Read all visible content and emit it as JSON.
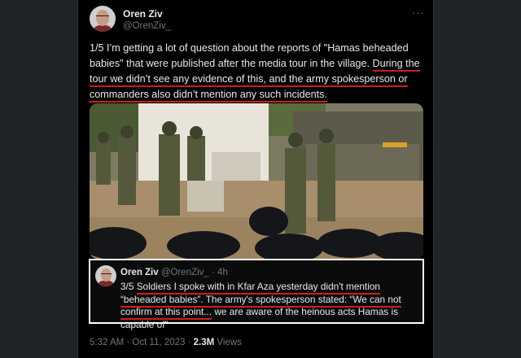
{
  "author": {
    "name": "Oren Ziv",
    "handle": "@OrenZiv_"
  },
  "menu": {
    "more_label": "···"
  },
  "tweet": {
    "text_part1": "1/5 I’m getting a lot of question about the reports of \"Hamas beheaded babies\" that were published after the media tour in the village. ",
    "text_underlined": "During the tour we didn’t see any evidence of this, and the army spokesperson or commanders also didn’t mention any such incidents.",
    "media": {
      "description_icon": "photo-soldiers-body-bags"
    }
  },
  "quote": {
    "name": "Oren Ziv",
    "handle_time": "@OrenZiv_ · 4h",
    "text_prefix": "3/5 ",
    "text_underlined_1": "Soldiers I spoke with in Kfar Aza yesterday didn't mention “beheaded babies”. The army's spokesperson stated: “We can not confirm at this point...",
    "text_rest": " we are aware of the heinous acts Hamas is capable of\""
  },
  "footer": {
    "time": "5:32 AM · Oct 11, 2023 · ",
    "views_count": "2.3M",
    "views_label": " Views"
  },
  "colors": {
    "background": "#202328",
    "tweet_bg": "#000000",
    "text": "#e7e9ea",
    "muted": "#71767b",
    "underline": "#d01c1c"
  }
}
